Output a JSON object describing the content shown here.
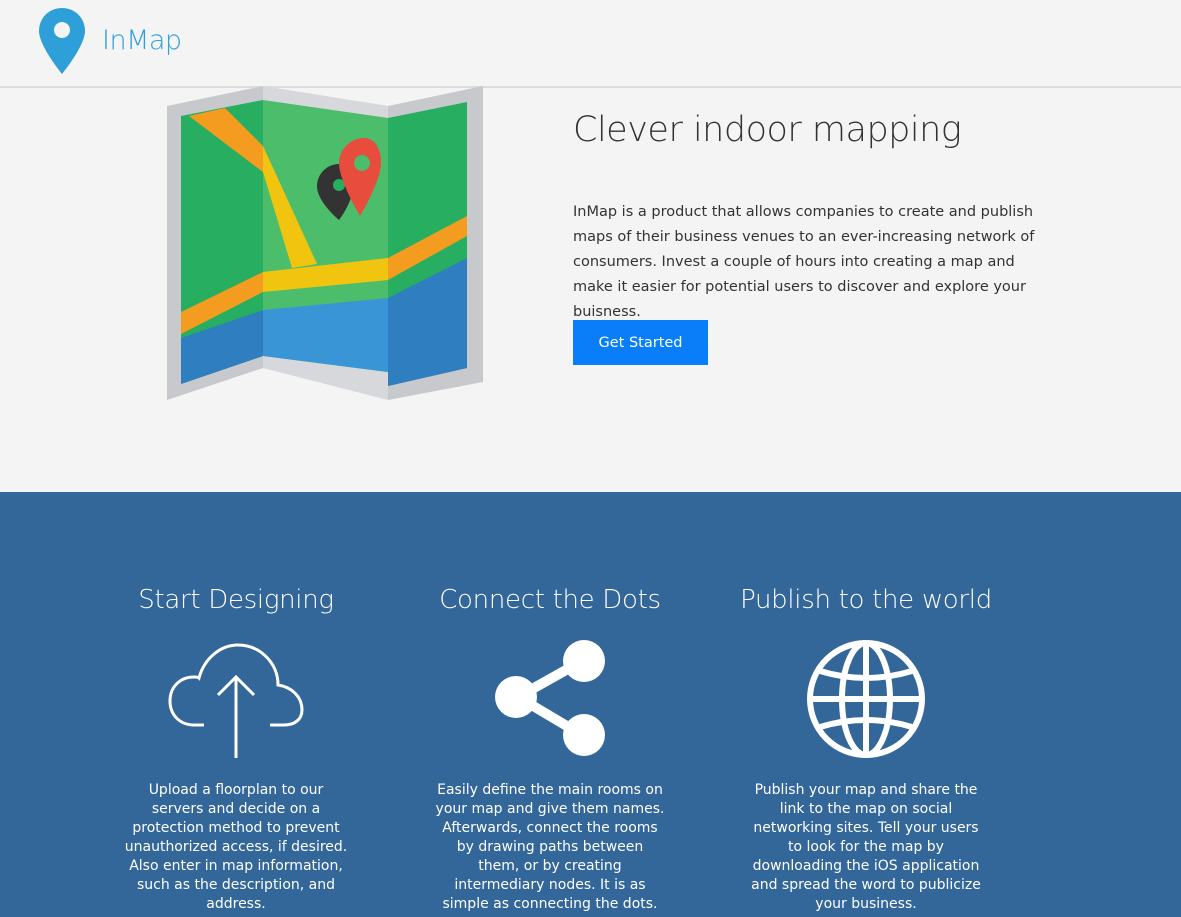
{
  "header": {
    "logo_icon": "map-pin-icon",
    "brand": "InMap",
    "brand_color": "#2e9fd8"
  },
  "hero": {
    "illustration": "folded-map-illustration",
    "title": "Clever indoor mapping",
    "description": "InMap is a product that allows companies to create and publish maps of their business venues to an ever-increasing network of consumers. Invest a couple of hours into creating a map and make it easier for potential users to discover and explore your buisness.",
    "cta_label": "Get Started",
    "cta_color": "#0a7ef9"
  },
  "features": {
    "background": "#336699",
    "items": [
      {
        "title": "Start Designing",
        "icon": "cloud-upload-icon",
        "description": "Upload a floorplan to our servers and decide on a protection method to prevent unauthorized access, if desired. Also enter in map information, such as the description, and address."
      },
      {
        "title": "Connect the Dots",
        "icon": "share-icon",
        "description": "Easily define the main rooms on your map and give them names. Afterwards, connect the rooms by drawing paths between them, or by creating intermediary nodes. It is as simple as connecting the dots."
      },
      {
        "title": "Publish to the world",
        "icon": "globe-icon",
        "description": "Publish your map and share the link to the map on social networking sites. Tell your users to look for the map by downloading the iOS application and spread the word to publicize your business."
      }
    ]
  }
}
